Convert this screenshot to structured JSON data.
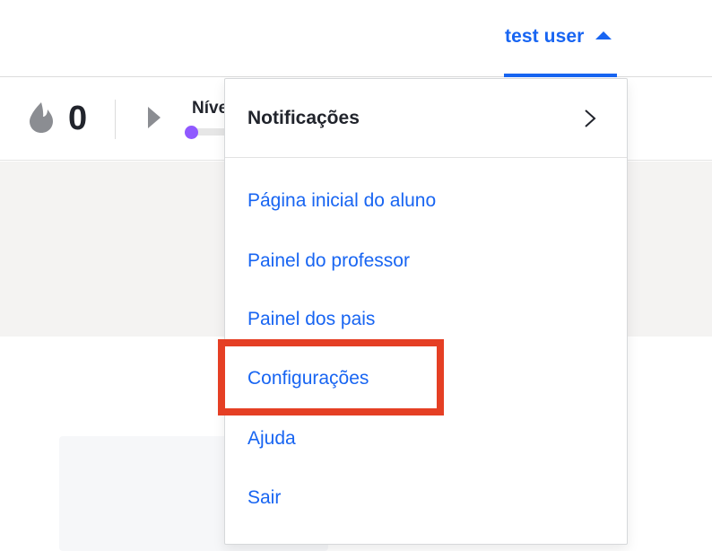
{
  "header": {
    "user_name": "test user"
  },
  "stats": {
    "streak_count": "0",
    "level_label": "Nível",
    "level_progress": 0
  },
  "dropdown": {
    "notifications_label": "Notificações",
    "items": [
      {
        "label": "Página inicial do aluno"
      },
      {
        "label": "Painel do professor"
      },
      {
        "label": "Painel dos pais"
      },
      {
        "label": "Configurações"
      },
      {
        "label": "Ajuda"
      },
      {
        "label": "Sair"
      }
    ],
    "highlighted_item": "Configurações"
  },
  "colors": {
    "accent": "#1865f2",
    "highlight": "#e53f24",
    "level": "#9059ff"
  },
  "icons": [
    "flame-icon",
    "play-icon",
    "caret-up-icon",
    "chevron-right-icon"
  ]
}
